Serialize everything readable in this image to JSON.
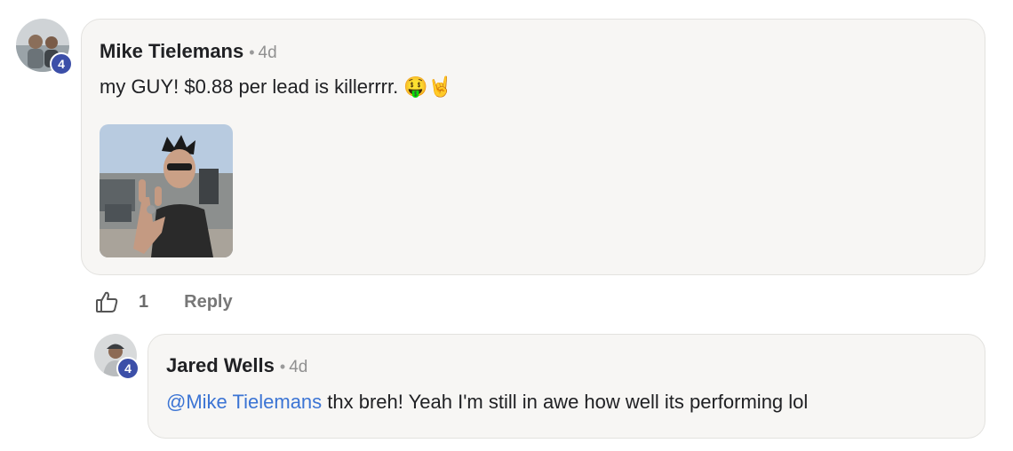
{
  "comment": {
    "author": "Mike Tielemans",
    "time": "4d",
    "text": "my GUY! $0.88 per lead is killerrrr.",
    "emojis": "🤑🤘",
    "level": "4",
    "gif_icon": "rock-on-gesture-gif"
  },
  "actions": {
    "like_count": "1",
    "reply_label": "Reply"
  },
  "reply": {
    "author": "Jared Wells",
    "time": "4d",
    "mention": "@Mike Tielemans",
    "text": " thx breh! Yeah I'm still in awe how well its performing lol",
    "level": "4"
  },
  "colors": {
    "bubble": "#f7f6f4",
    "badge": "#3c4fa8",
    "mention": "#3b74d4"
  }
}
